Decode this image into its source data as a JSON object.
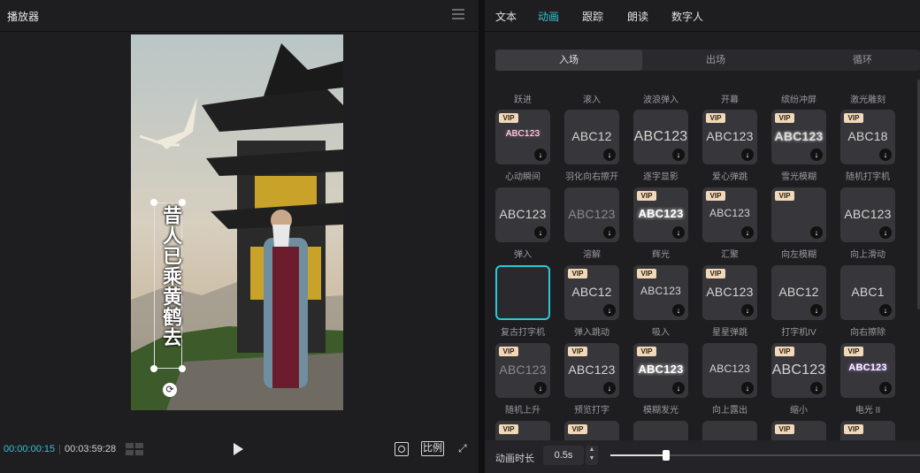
{
  "player": {
    "title": "播放器",
    "subtitle_text": "昔人已乘黄鹤去",
    "time_current": "00:00:00:15",
    "time_total": "00:03:59:28",
    "ratio_label": "比例"
  },
  "panel": {
    "tabs": [
      {
        "label": "文本",
        "active": false
      },
      {
        "label": "动画",
        "active": true
      },
      {
        "label": "跟踪",
        "active": false
      },
      {
        "label": "朗读",
        "active": false
      },
      {
        "label": "数字人",
        "active": false
      }
    ],
    "subtabs": [
      {
        "label": "入场",
        "active": true
      },
      {
        "label": "出场",
        "active": false
      },
      {
        "label": "循环",
        "active": false
      }
    ],
    "top_labels": [
      "跃进",
      "滚入",
      "波浪弹入",
      "开幕",
      "缤纷冲屏",
      "激光雕刻"
    ],
    "rows": [
      {
        "cards": [
          {
            "preview": "ABC123",
            "vip": true,
            "style": "hearts"
          },
          {
            "preview": "ABC12",
            "vip": false
          },
          {
            "preview": "ABC123",
            "vip": false,
            "style": "big"
          },
          {
            "preview": "ABC123",
            "vip": true
          },
          {
            "preview": "ABC123",
            "vip": true,
            "style": "blur"
          },
          {
            "preview": "ABC18",
            "vip": true
          }
        ],
        "labels": [
          "心动瞬间",
          "羽化向右擦开",
          "逐字显影",
          "爱心弹跳",
          "雪光模糊",
          "随机打字机"
        ]
      },
      {
        "cards": [
          {
            "preview": "ABC123",
            "vip": false
          },
          {
            "preview": "ABC123",
            "vip": false,
            "style": "dim"
          },
          {
            "preview": "ABC123",
            "vip": true,
            "style": "glow"
          },
          {
            "preview": "ABC123",
            "vip": true,
            "style": "small"
          },
          {
            "preview": "",
            "vip": true
          },
          {
            "preview": "ABC123",
            "vip": false
          }
        ],
        "labels": [
          "弹入",
          "溶解",
          "辉光",
          "汇聚",
          "向左模糊",
          "向上滑动"
        ]
      },
      {
        "cards": [
          {
            "preview": "",
            "vip": false,
            "selected": true
          },
          {
            "preview": "ABC12",
            "vip": true
          },
          {
            "preview": "ABC123",
            "vip": true,
            "style": "tiny"
          },
          {
            "preview": "ABC123",
            "vip": true
          },
          {
            "preview": "ABC12",
            "vip": false
          },
          {
            "preview": "ABC1",
            "vip": false
          }
        ],
        "labels": [
          "复古打字机",
          "弹入跳动",
          "吸入",
          "星星弹跳",
          "打字机IV",
          "向右擦除"
        ]
      },
      {
        "cards": [
          {
            "preview": "ABC123",
            "vip": true,
            "style": "dim"
          },
          {
            "preview": "ABC123",
            "vip": true
          },
          {
            "preview": "ABC123",
            "vip": true,
            "style": "glow"
          },
          {
            "preview": "ABC123",
            "vip": false,
            "style": "tiny"
          },
          {
            "preview": "ABC123",
            "vip": true,
            "style": "big"
          },
          {
            "preview": "ABC123",
            "vip": true,
            "style": "electric"
          }
        ],
        "labels": [
          "随机上升",
          "预览打字",
          "模糊发光",
          "向上露出",
          "缩小",
          "电光 II"
        ]
      },
      {
        "cards": [
          {
            "preview": "",
            "vip": true
          },
          {
            "preview": "",
            "vip": true
          },
          {
            "preview": "",
            "vip": false
          },
          {
            "preview": "",
            "vip": false
          },
          {
            "preview": "",
            "vip": true
          },
          {
            "preview": "",
            "vip": true
          }
        ],
        "labels": []
      }
    ],
    "duration_label": "动画时长",
    "duration_value": "0.5s",
    "duration_fraction": 0.18
  },
  "icons": {
    "menu": "menu-icon",
    "play": "play-icon",
    "download": "download-icon",
    "vip": "vip-badge"
  },
  "colors": {
    "accent": "#35c3d6",
    "vip": "#f1d8b8",
    "background": "#1e1e21"
  }
}
